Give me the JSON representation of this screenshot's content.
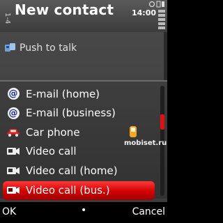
{
  "header": {
    "title": "New contact",
    "time": "14:00",
    "side_label": "1-4"
  },
  "form": {
    "field_label": "Push to talk"
  },
  "popup": {
    "items": [
      {
        "label": "E-mail (home)",
        "icon": "email-icon"
      },
      {
        "label": "E-mail (business)",
        "icon": "email-icon"
      },
      {
        "label": "Car phone",
        "icon": "car-icon"
      },
      {
        "label": "Video call",
        "icon": "video-call-icon"
      },
      {
        "label": "Video call (home)",
        "icon": "video-call-icon"
      },
      {
        "label": "Video call (bus.)",
        "icon": "video-call-icon",
        "selected": true
      }
    ],
    "scroll_position": 0.3
  },
  "watermark": {
    "text": "mobiset.ru"
  },
  "softkeys": {
    "left": "OK",
    "middle": "•",
    "right": "Cancel"
  },
  "colors": {
    "selection": "#e00000",
    "email_icon": "#1d2f8c",
    "car_icon": "#d42020"
  }
}
